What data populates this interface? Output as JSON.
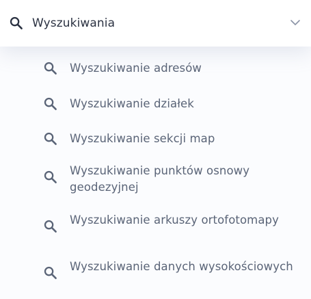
{
  "section": {
    "title": "Wyszukiwania",
    "icon": "search-icon",
    "toggle_icon": "chevron-down-icon",
    "expanded": true
  },
  "items": [
    {
      "label": "Wyszukiwanie adresów",
      "icon": "search-icon"
    },
    {
      "label": "Wyszukiwanie działek",
      "icon": "search-icon"
    },
    {
      "label": "Wyszukiwanie sekcji map",
      "icon": "search-icon"
    },
    {
      "label": "Wyszukiwanie punktów osnowy geodezyjnej",
      "icon": "search-icon"
    },
    {
      "label": "Wyszukiwanie arkuszy ortofotomapy",
      "icon": "search-icon"
    },
    {
      "label": "Wyszukiwanie danych wysokościowych",
      "icon": "search-icon"
    }
  ],
  "colors": {
    "header_text": "#2b3242",
    "item_text": "#5a6477",
    "icon_dark": "#2b3242",
    "icon_muted": "#5a6477",
    "chevron": "#8a93a6",
    "background": "#fbfcfe"
  }
}
